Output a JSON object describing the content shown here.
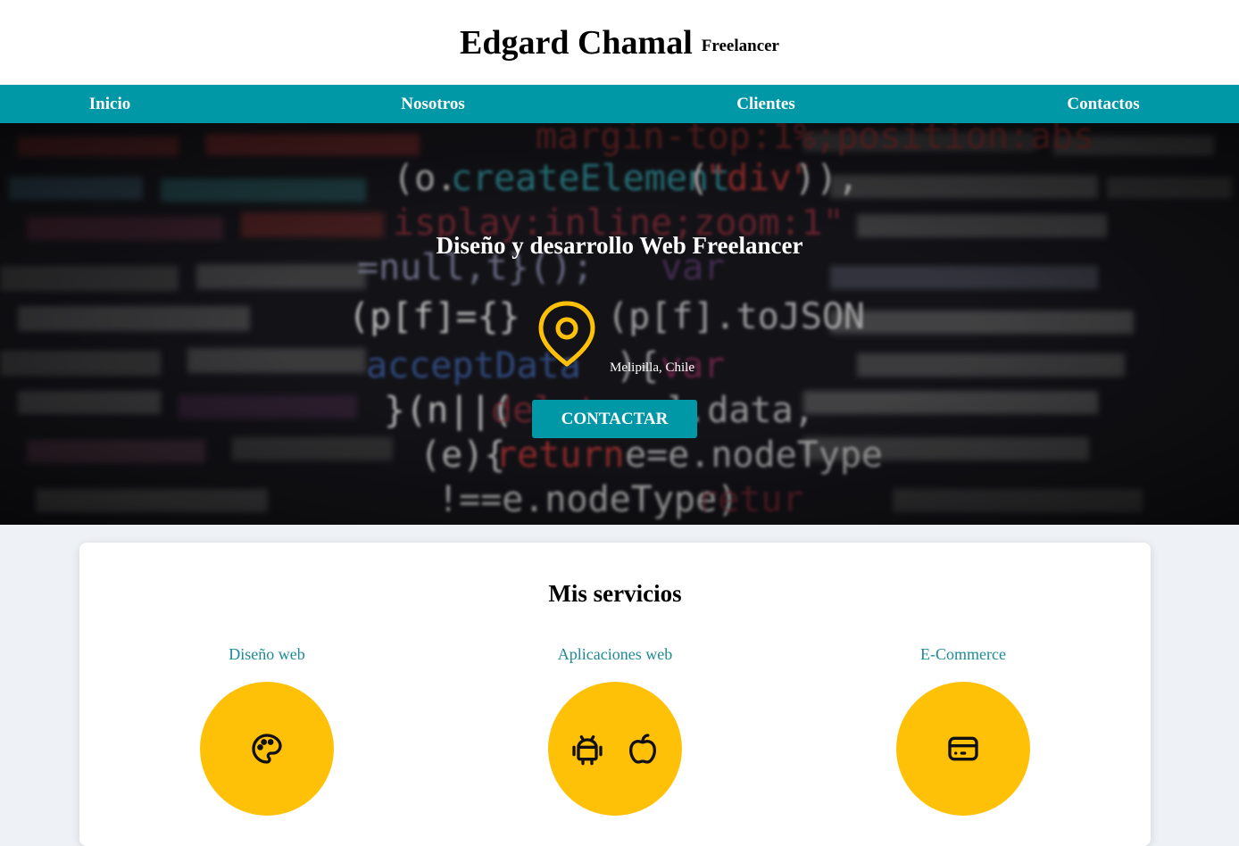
{
  "header": {
    "title": "Edgard Chamal",
    "subtitle": "Freelancer"
  },
  "nav": {
    "items": [
      "Inicio",
      "Nosotros",
      "Clientes",
      "Contactos"
    ]
  },
  "hero": {
    "title": "Diseño y desarrollo Web Freelancer",
    "location": "Melipilla, Chile",
    "cta_label": "CONTACTAR",
    "icon": "map-pin-icon"
  },
  "services": {
    "title": "Mis servicios",
    "items": [
      {
        "name": "Diseño web",
        "icons": [
          "palette-icon"
        ]
      },
      {
        "name": "Aplicaciones web",
        "icons": [
          "android-icon",
          "apple-icon"
        ]
      },
      {
        "name": "E-Commerce",
        "icons": [
          "credit-card-icon"
        ]
      }
    ]
  },
  "colors": {
    "accent": "#0097a7",
    "highlight": "#ffc107",
    "service_text": "#1e8a96"
  }
}
